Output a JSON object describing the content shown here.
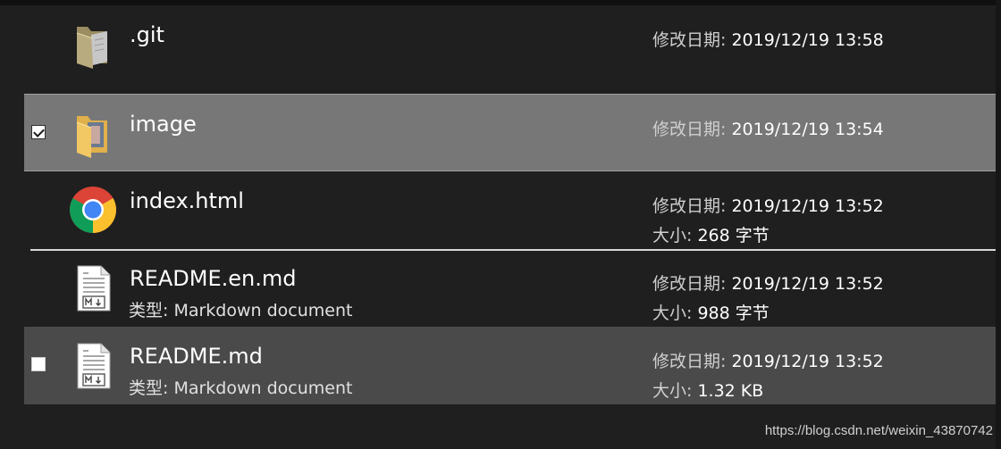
{
  "files": [
    {
      "name": ".git",
      "icon": "folder-icon",
      "modified_label": "修改日期:",
      "modified": "2019/12/19 13:58"
    },
    {
      "name": "image",
      "icon": "image-folder-icon",
      "modified_label": "修改日期:",
      "modified": "2019/12/19 13:54",
      "checked": true
    },
    {
      "name": "index.html",
      "icon": "chrome-icon",
      "modified_label": "修改日期:",
      "modified": "2019/12/19 13:52",
      "size_label": "大小:",
      "size": "268 字节"
    },
    {
      "name": "README.en.md",
      "icon": "markdown-file-icon",
      "type_label": "类型:",
      "type": "Markdown document",
      "modified_label": "修改日期:",
      "modified": "2019/12/19 13:52",
      "size_label": "大小:",
      "size": "988 字节"
    },
    {
      "name": "README.md",
      "icon": "markdown-file-icon",
      "type_label": "类型:",
      "type": "Markdown document",
      "modified_label": "修改日期:",
      "modified": "2019/12/19 13:52",
      "size_label": "大小:",
      "size": "1.32 KB",
      "checked": false
    }
  ],
  "watermark": "https://blog.csdn.net/weixin_43870742",
  "colors": {
    "background": "#1f1f1f",
    "selected": "#777777",
    "hover": "#4a4a4a"
  }
}
